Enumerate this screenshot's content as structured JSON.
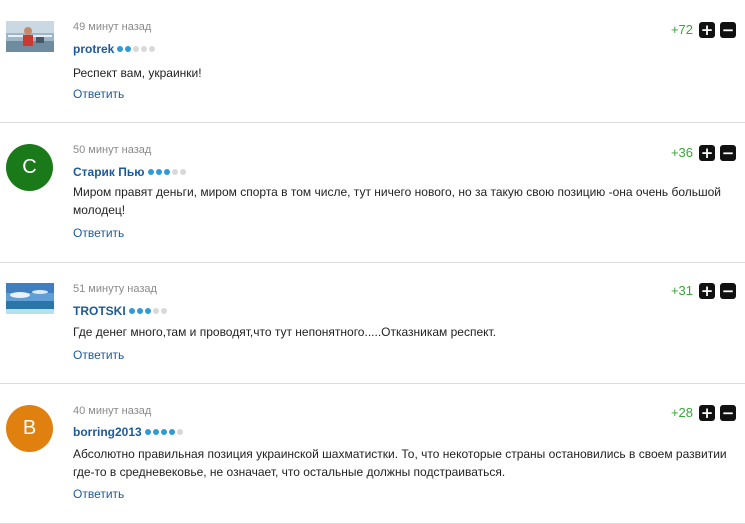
{
  "comments": [
    {
      "time": "49 минут назад",
      "author": "protrek",
      "rating_level": 2,
      "text": "Респект вам, украинки!",
      "reply_label": "Ответить",
      "score": "+72",
      "avatar_type": "photo-person"
    },
    {
      "time": "50 минут назад",
      "author": "Старик Пью",
      "rating_level": 3,
      "text": "Миром правят деньги, миром спорта в том числе, тут ничего нового, но за такую свою позицию -она очень большой молодец!",
      "reply_label": "Ответить",
      "score": "+36",
      "avatar_letter": "С",
      "avatar_color": "#1a7a1a"
    },
    {
      "time": "51 минуту назад",
      "author": "TROTSKI",
      "rating_level": 3,
      "text": "Где денег много,там и проводят,что тут непонятного.....Отказникам респект.",
      "reply_label": "Ответить",
      "score": "+31",
      "avatar_type": "photo-sea"
    },
    {
      "time": "40 минут назад",
      "author": "borring2013",
      "rating_level": 4,
      "text": "Абсолютно правильная позиция украинской шахматистки. То, что некоторые страны остановились в своем развитии где-то в средневековье, не означает, что остальные должны подстраиваться.",
      "reply_label": "Ответить",
      "score": "+28",
      "avatar_letter": "B",
      "avatar_color": "#e0800f"
    }
  ],
  "vote": {
    "plus": "+",
    "minus": "−"
  },
  "colors": {
    "author": "#1d5a99",
    "score": "#3aa53a",
    "rating_dot_on": "#2e9bd6",
    "rating_dot_off": "#d8d8d8"
  },
  "rating_max": 5
}
